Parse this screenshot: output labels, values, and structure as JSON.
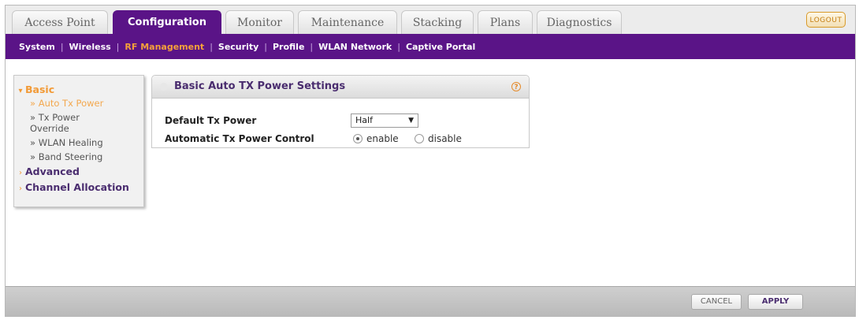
{
  "top_tabs": [
    {
      "label": "Access Point"
    },
    {
      "label": "Configuration"
    },
    {
      "label": "Monitor"
    },
    {
      "label": "Maintenance"
    },
    {
      "label": "Stacking"
    },
    {
      "label": "Plans"
    },
    {
      "label": "Diagnostics"
    }
  ],
  "active_tab": "Configuration",
  "logout_label": "LOGOUT",
  "subnav": {
    "items": [
      "System",
      "Wireless",
      "RF Management",
      "Security",
      "Profile",
      "WLAN Network",
      "Captive Portal"
    ],
    "active": "RF Management"
  },
  "left_menu": {
    "basic": "Basic",
    "auto_tx_power": "Auto Tx Power",
    "tx_power_override_1": "Tx Power",
    "tx_power_override_2": "Override",
    "wlan_healing": "WLAN Healing",
    "band_steering": "Band Steering",
    "advanced": "Advanced",
    "channel_allocation": "Channel Allocation"
  },
  "panel": {
    "title": "Basic Auto TX Power Settings",
    "help_glyph": "?",
    "default_tx_label": "Default Tx Power",
    "default_tx_value": "Half",
    "auto_tx_label": "Automatic Tx Power Control",
    "enable_label": "enable",
    "disable_label": "disable",
    "selected": "enable"
  },
  "footer": {
    "cancel_label": "CANCEL",
    "apply_label": "APPLY"
  },
  "colors": {
    "brand_purple": "#5a1487",
    "accent_orange": "#f29a36"
  }
}
